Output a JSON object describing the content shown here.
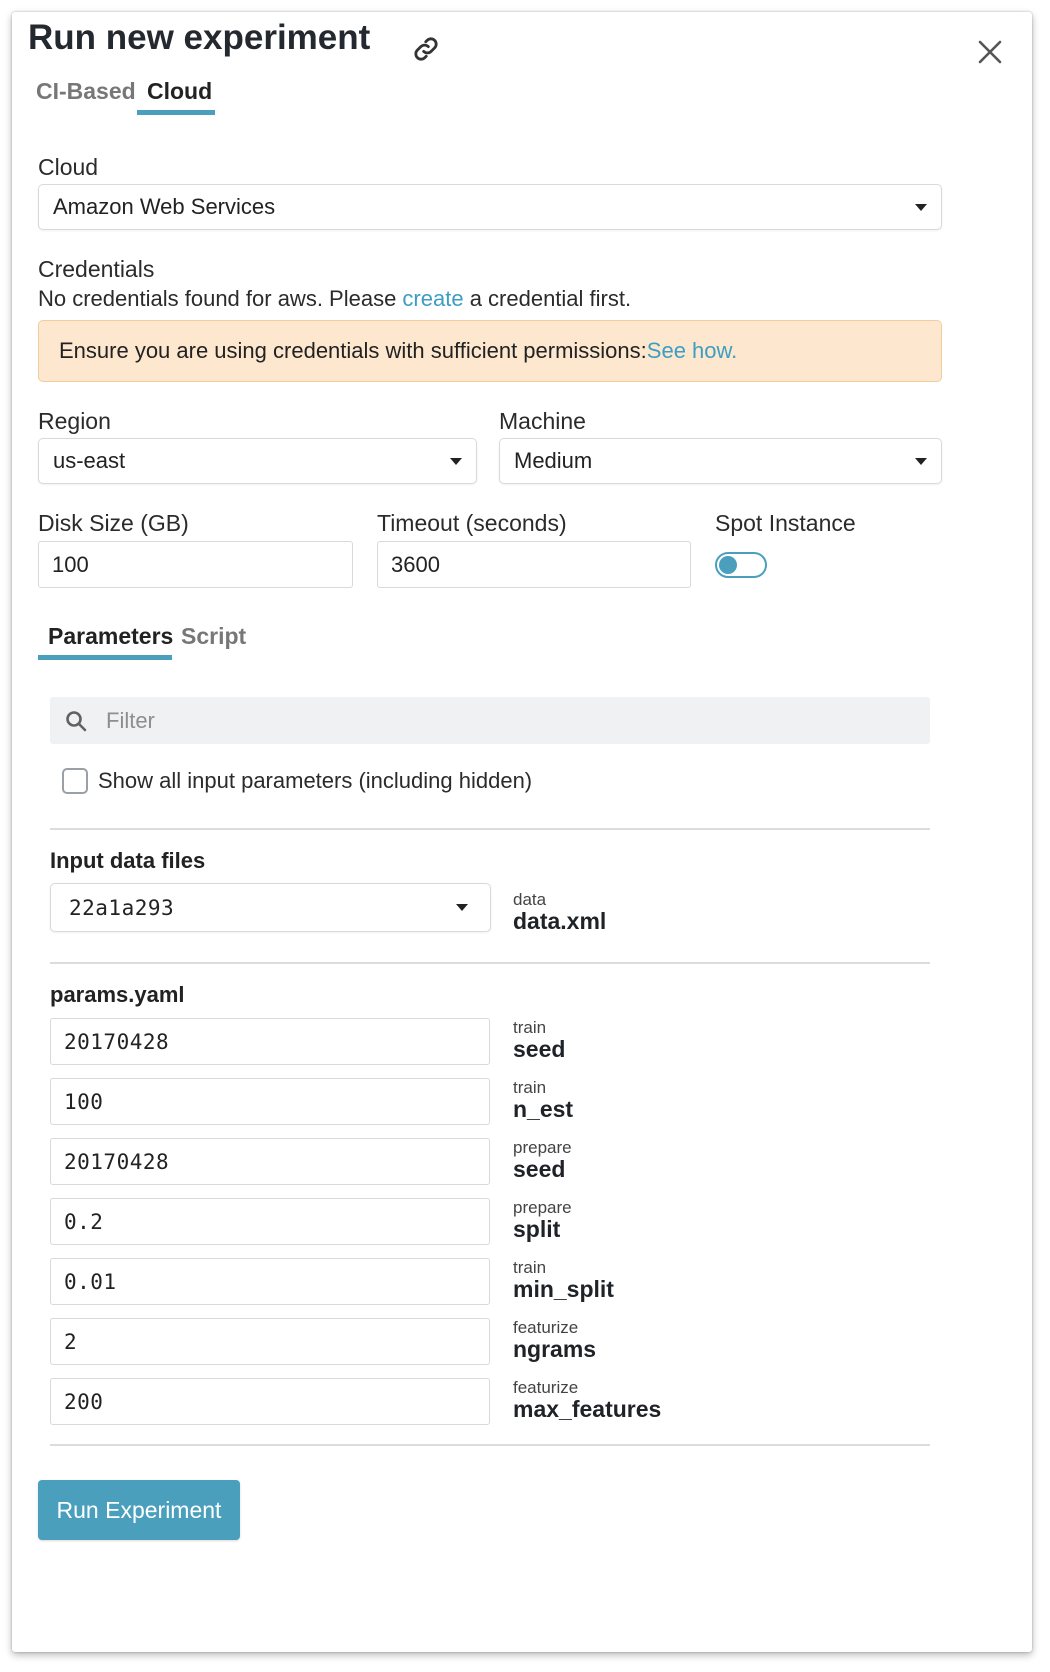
{
  "dialog": {
    "title": "Run new experiment"
  },
  "tabs": [
    {
      "label": "CI-Based",
      "active": false
    },
    {
      "label": "Cloud",
      "active": true
    }
  ],
  "cloud": {
    "label": "Cloud",
    "selected": "Amazon Web Services"
  },
  "credentials": {
    "label": "Credentials",
    "message_before": "No credentials found for aws. Please ",
    "message_link": "create",
    "message_after": " a credential first."
  },
  "warning": {
    "text": "Ensure you are using credentials with sufficient permissions: ",
    "link": "See how."
  },
  "region": {
    "label": "Region",
    "selected": "us-east"
  },
  "machine": {
    "label": "Machine",
    "selected": "Medium"
  },
  "disk_size": {
    "label": "Disk Size (GB)",
    "value": "100"
  },
  "timeout": {
    "label": "Timeout (seconds)",
    "value": "3600"
  },
  "spot_instance": {
    "label": "Spot Instance",
    "enabled": false
  },
  "sub_tabs": [
    {
      "label": "Parameters",
      "active": true
    },
    {
      "label": "Script",
      "active": false
    }
  ],
  "filter": {
    "placeholder": "Filter"
  },
  "show_hidden": {
    "label": "Show all input parameters (including hidden)",
    "checked": false
  },
  "input_data": {
    "title": "Input data files",
    "selected": "22a1a293",
    "group": "data",
    "name": "data.xml"
  },
  "params": {
    "title": "params.yaml",
    "items": [
      {
        "value": "20170428",
        "group": "train",
        "name": "seed"
      },
      {
        "value": "100",
        "group": "train",
        "name": "n_est"
      },
      {
        "value": "20170428",
        "group": "prepare",
        "name": "seed"
      },
      {
        "value": "0.2",
        "group": "prepare",
        "name": "split"
      },
      {
        "value": "0.01",
        "group": "train",
        "name": "min_split"
      },
      {
        "value": "2",
        "group": "featurize",
        "name": "ngrams"
      },
      {
        "value": "200",
        "group": "featurize",
        "name": "max_features"
      }
    ]
  },
  "run_button": {
    "label": "Run Experiment"
  },
  "colors": {
    "accent": "#4a9fbd",
    "link": "#3d9dc2",
    "warning_bg": "#fde8cf",
    "warning_border": "#f2cc9e",
    "filter_bg": "#eff1f2"
  },
  "icons": {
    "title_link": "link-icon",
    "close": "close-icon",
    "search": "search-icon",
    "dropdown": "caret-down-icon"
  }
}
